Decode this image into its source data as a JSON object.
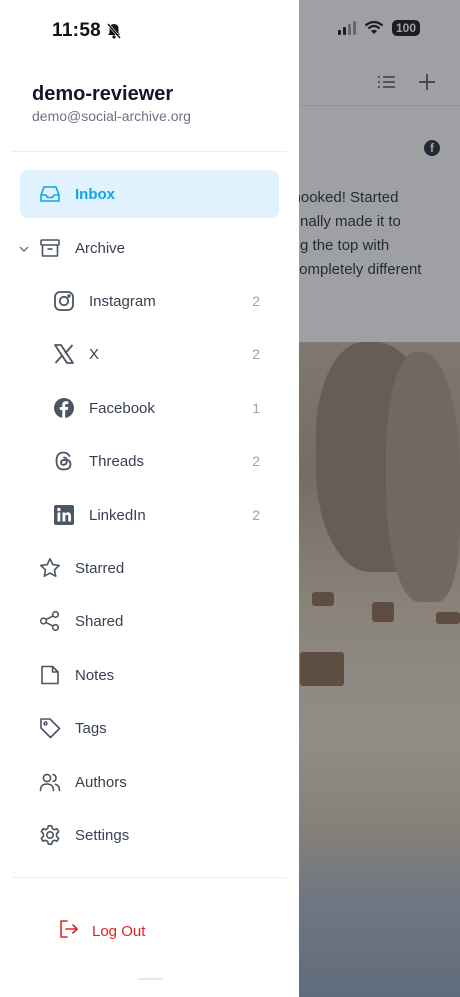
{
  "status": {
    "time": "11:58",
    "battery": "100"
  },
  "user": {
    "name": "demo-reviewer",
    "email": "demo@social-archive.org"
  },
  "background": {
    "post_lines": [
      "n hooked! Started",
      "d finally made it to",
      "hing the top with",
      "s completely different"
    ]
  },
  "nav": {
    "inbox": "Inbox",
    "archive": "Archive",
    "archive_items": [
      {
        "label": "Instagram",
        "count": "2"
      },
      {
        "label": "X",
        "count": "2"
      },
      {
        "label": "Facebook",
        "count": "1"
      },
      {
        "label": "Threads",
        "count": "2"
      },
      {
        "label": "LinkedIn",
        "count": "2"
      }
    ],
    "starred": "Starred",
    "shared": "Shared",
    "notes": "Notes",
    "tags": "Tags",
    "authors": "Authors",
    "settings": "Settings"
  },
  "logout": "Log Out",
  "colors": {
    "accent": "#0ea5e9",
    "active_bg": "#e0f2fe",
    "danger": "#dc2626"
  }
}
